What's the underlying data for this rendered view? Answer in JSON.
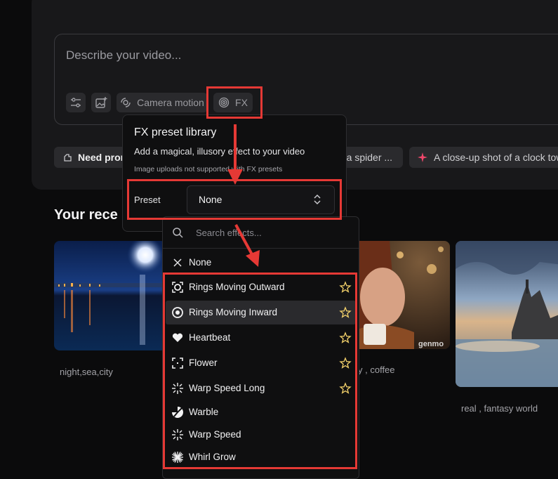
{
  "prompt": {
    "placeholder": "Describe your video...",
    "tools": {
      "camera_motion_label": "Camera motion",
      "fx_label": "FX"
    }
  },
  "suggestions": [
    {
      "label": "Need prom"
    },
    {
      "label": "n a spider ..."
    },
    {
      "label": "A close-up shot of a clock towe"
    }
  ],
  "recent": {
    "title": "Your rece",
    "items": [
      {
        "caption": "night,sea,city"
      },
      {
        "caption": "y , coffee",
        "watermark": "genmo"
      },
      {
        "caption": "real , fantasy world"
      }
    ]
  },
  "fx_popup": {
    "title": "FX preset library",
    "description": "Add a magical, illusory effect to your video",
    "note": "Image uploads not supported with FX presets",
    "preset_label": "Preset",
    "preset_value": "None"
  },
  "dropdown": {
    "search_placeholder": "Search effects...",
    "none_label": "None",
    "options": [
      {
        "label": "Rings Moving Outward",
        "icon": "rings-outward-icon",
        "starred_icon": true
      },
      {
        "label": "Rings Moving Inward",
        "icon": "rings-inward-icon",
        "starred_icon": true,
        "highlighted": true
      },
      {
        "label": "Heartbeat",
        "icon": "heart-icon",
        "starred_icon": true
      },
      {
        "label": "Flower",
        "icon": "flower-icon",
        "starred_icon": true
      },
      {
        "label": "Warp Speed Long",
        "icon": "warp-icon",
        "starred_icon": true
      },
      {
        "label": "Warble",
        "icon": "warble-icon",
        "starred_icon": false
      },
      {
        "label": "Warp Speed",
        "icon": "warp-icon",
        "starred_icon": false
      },
      {
        "label": "Whirl Grow",
        "icon": "whirl-icon",
        "starred_icon": false
      }
    ]
  },
  "colors": {
    "annotation_red": "#e53935",
    "star_yellow": "#f5d36b",
    "sparkle_pink": "#f0476b"
  }
}
